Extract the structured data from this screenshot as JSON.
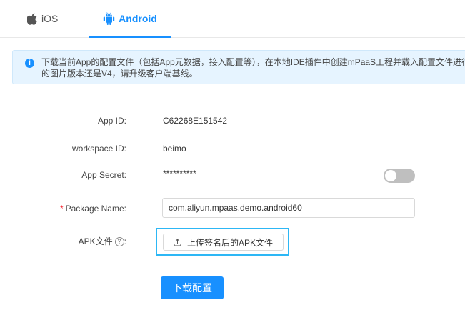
{
  "tabs": [
    {
      "label": "iOS",
      "icon": "apple-icon",
      "active": false
    },
    {
      "label": "Android",
      "icon": "android-icon",
      "active": true
    }
  ],
  "colors": {
    "accent": "#1890ff",
    "highlight_border": "#2db7f5",
    "required": "#f5222d"
  },
  "alert": {
    "icon": "info-icon",
    "line1": "下载当前App的配置文件（包括App元数据，接入配置等），在本地IDE插件中创建mPaaS工程并载入配置文件进行",
    "line2": "的图片版本还是V4，请升级客户端基线。"
  },
  "form": {
    "app_id": {
      "label": "App ID:",
      "value": "C62268E151542"
    },
    "workspace_id": {
      "label": "workspace ID:",
      "value": "beimo"
    },
    "app_secret": {
      "label": "App Secret:",
      "value": "**********",
      "toggle_on": false
    },
    "package_name": {
      "required_mark": "*",
      "label": "Package Name:",
      "value": "com.aliyun.mpaas.demo.android60"
    },
    "apk_file": {
      "label": "APK文件",
      "help_icon": "?",
      "separator": ":",
      "upload_label": "上传签名后的APK文件"
    }
  },
  "actions": {
    "download_label": "下载配置"
  }
}
